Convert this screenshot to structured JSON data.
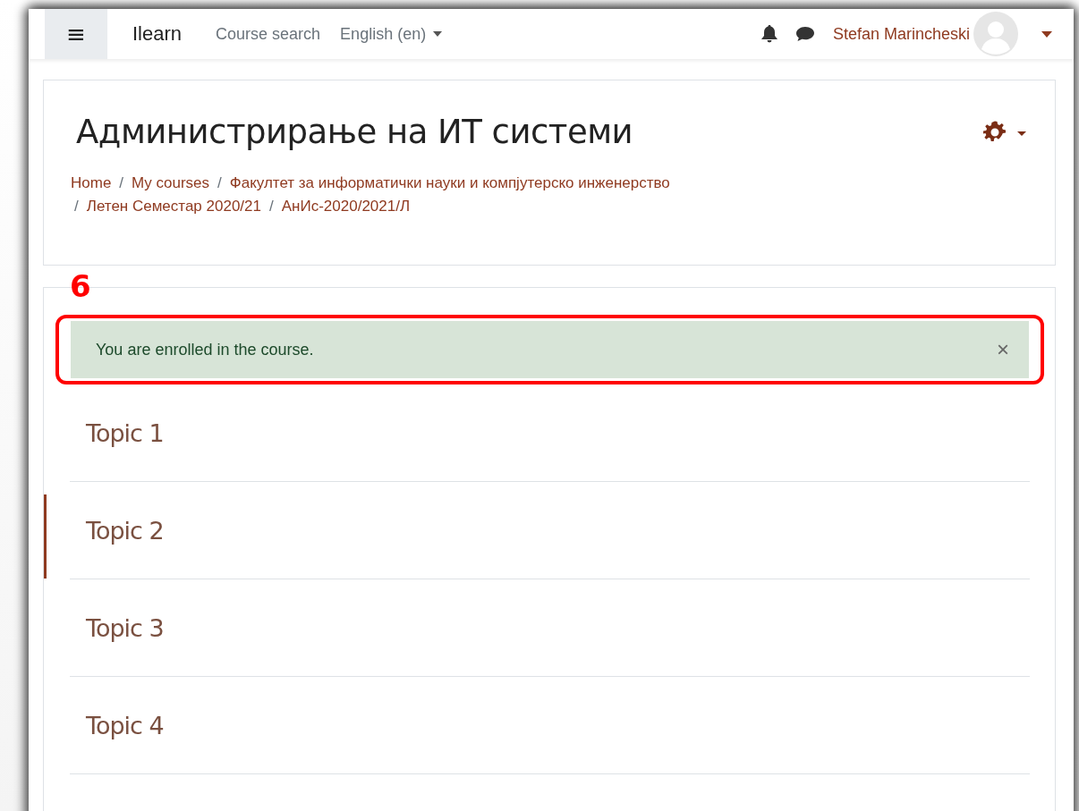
{
  "navbar": {
    "menu_icon": "≡",
    "site_name": "Ilearn",
    "links": [
      {
        "label": "Course search",
        "kind": "link"
      },
      {
        "label": "English (en)",
        "kind": "dropdown"
      }
    ],
    "user_name": "Stefan Marincheski"
  },
  "header": {
    "title": "Администрирање на ИТ системи",
    "breadcrumbs": [
      {
        "label": "Home"
      },
      {
        "separator": "/",
        "label": "My courses"
      },
      {
        "separator": "/",
        "label": "Факултет за информатички науки и компјутерско инженерство"
      },
      {
        "separator": "/",
        "label": "Летен Семестар 2020/21"
      },
      {
        "separator": "/",
        "label": "АнИс-2020/2021/Л"
      }
    ]
  },
  "alert": {
    "message": "You are enrolled in the course.",
    "close": "×"
  },
  "annotation": {
    "number": "6"
  },
  "topics": [
    {
      "title": "Topic 1",
      "current": false
    },
    {
      "title": "Topic 2",
      "current": true
    },
    {
      "title": "Topic 3",
      "current": false
    },
    {
      "title": "Topic 4",
      "current": false
    }
  ]
}
